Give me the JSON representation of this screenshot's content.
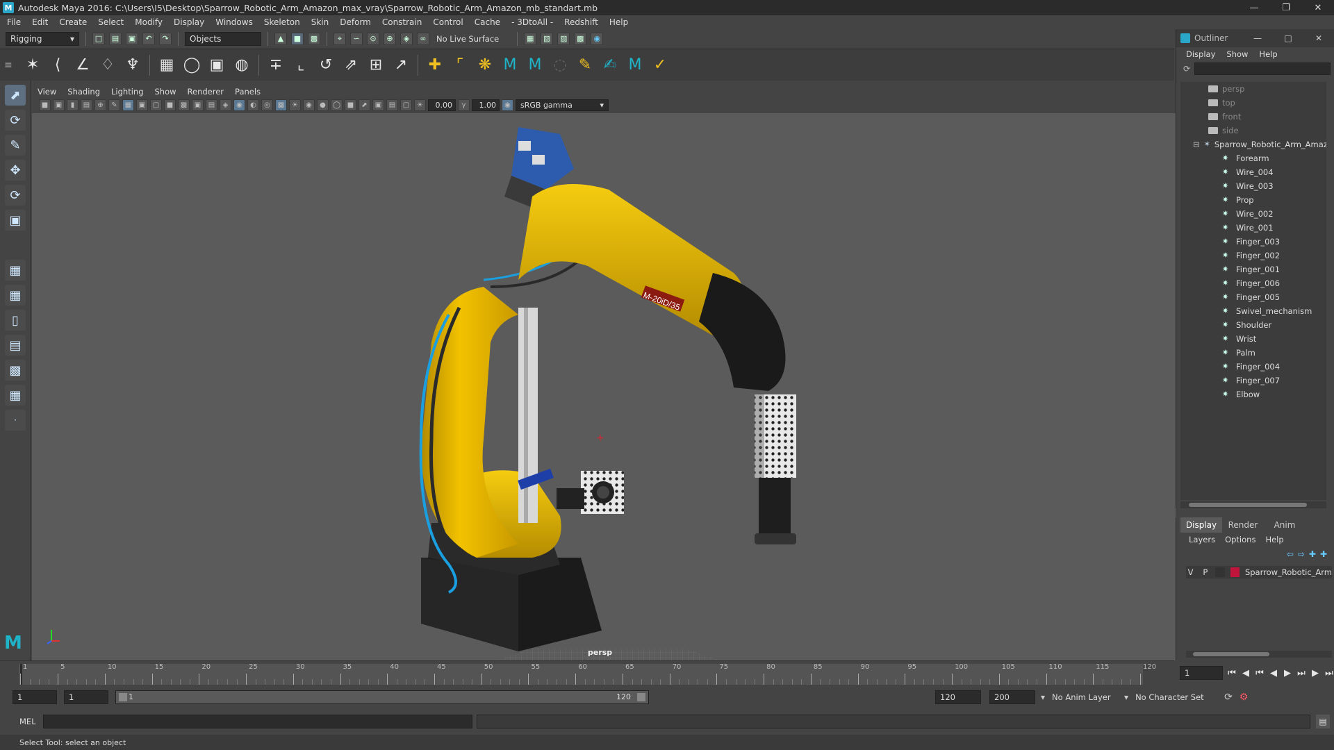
{
  "window": {
    "title": "Autodesk Maya 2016: C:\\Users\\I5\\Desktop\\Sparrow_Robotic_Arm_Amazon_max_vray\\Sparrow_Robotic_Arm_Amazon_mb_standart.mb",
    "logo": "M"
  },
  "menus": [
    "File",
    "Edit",
    "Create",
    "Select",
    "Modify",
    "Display",
    "Windows",
    "Skeleton",
    "Skin",
    "Deform",
    "Constrain",
    "Control",
    "Cache",
    "- 3DtoAll -",
    "Redshift",
    "Help"
  ],
  "status": {
    "menuset": "Rigging",
    "select_mode": "Objects",
    "live_surface": "No Live Surface"
  },
  "viewport": {
    "menus": [
      "View",
      "Shading",
      "Lighting",
      "Show",
      "Renderer",
      "Panels"
    ],
    "exposure": "0.00",
    "gamma": "1.00",
    "colorspace": "sRGB gamma",
    "camera": "persp",
    "model_label": "M-20iD/35"
  },
  "outliner": {
    "title": "Outliner",
    "menus": [
      "Display",
      "Show",
      "Help"
    ],
    "cameras": [
      "persp",
      "top",
      "front",
      "side"
    ],
    "root": "Sparrow_Robotic_Arm_Amaz",
    "children": [
      "Forearm",
      "Wire_004",
      "Wire_003",
      "Prop",
      "Wire_002",
      "Wire_001",
      "Finger_003",
      "Finger_002",
      "Finger_001",
      "Finger_006",
      "Finger_005",
      "Swivel_mechanism",
      "Shoulder",
      "Wrist",
      "Palm",
      "Finger_004",
      "Finger_007",
      "Elbow"
    ]
  },
  "layers": {
    "tabs": [
      "Display",
      "Render",
      "Anim"
    ],
    "active_tab": "Display",
    "menus": [
      "Layers",
      "Options",
      "Help"
    ],
    "layer": {
      "v": "V",
      "p": "P",
      "name": "Sparrow_Robotic_Arm",
      "color": "#c0143c"
    }
  },
  "timeline": {
    "ticks": [
      1,
      5,
      10,
      15,
      20,
      25,
      30,
      35,
      40,
      45,
      50,
      55,
      60,
      65,
      70,
      75,
      80,
      85,
      90,
      95,
      100,
      105,
      110,
      115,
      120
    ],
    "start": 1,
    "end": 120,
    "current_frame": "1",
    "current": 1
  },
  "range": {
    "start": "1",
    "anim_start": "1",
    "range_start_label": "1",
    "range_end_label": "120",
    "end": "120",
    "anim_end": "200",
    "anim_layer": "No Anim Layer",
    "char_set": "No Character Set"
  },
  "cmdline": {
    "lang": "MEL"
  },
  "helpline": "Select Tool: select an object"
}
